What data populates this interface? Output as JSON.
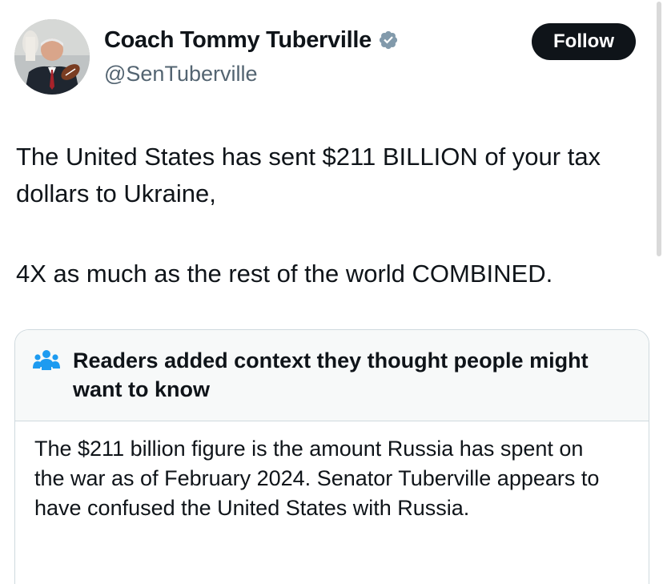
{
  "author": {
    "display_name": "Coach Tommy Tuberville",
    "handle": "@SenTuberville",
    "verified_icon": "verified-badge-icon",
    "follow_label": "Follow"
  },
  "tweet": {
    "paragraphs": [
      "The United States has sent $211 BILLION of your tax dollars to Ukraine,",
      "4X as much as the rest of the world COMBINED."
    ]
  },
  "community_note": {
    "icon": "people-icon",
    "title": "Readers added context they thought people might want to know",
    "body": "The $211 billion figure is the amount Russia has spent on the war as of February 2024. Senator Tuberville appears to have confused the United States with Russia."
  },
  "colors": {
    "text": "#0f1419",
    "secondary_text": "#536471",
    "verified_badge": "#829aab",
    "note_icon": "#1d9bf0",
    "note_header_bg": "#f7f9f9",
    "border": "#cfd9de"
  }
}
